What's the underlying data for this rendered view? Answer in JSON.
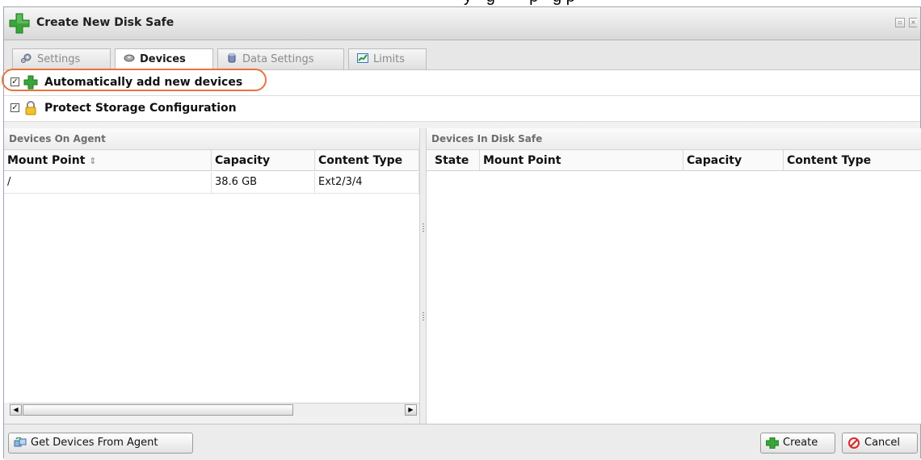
{
  "window": {
    "title": "Create New Disk Safe"
  },
  "tabs": [
    {
      "label": "Settings",
      "icon": "gear-icon"
    },
    {
      "label": "Devices",
      "icon": "disk-icon"
    },
    {
      "label": "Data Settings",
      "icon": "database-icon"
    },
    {
      "label": "Limits",
      "icon": "chart-icon"
    }
  ],
  "active_tab": "Devices",
  "options": {
    "auto_add": {
      "label": "Automatically add new devices",
      "checked": true
    },
    "protect_storage": {
      "label": "Protect Storage Configuration",
      "checked": true
    }
  },
  "agent_panel": {
    "title": "Devices On Agent",
    "columns": [
      "Mount Point",
      "Capacity",
      "Content Type"
    ],
    "sort_indicator": "⇕",
    "rows": [
      {
        "mount_point": "/",
        "capacity": "38.6 GB",
        "content_type": "Ext2/3/4"
      }
    ]
  },
  "safe_panel": {
    "title": "Devices In Disk Safe",
    "columns": [
      "State",
      "Mount Point",
      "Capacity",
      "Content Type"
    ],
    "rows": []
  },
  "footer": {
    "get_devices_label": "Get Devices From Agent",
    "create_label": "Create",
    "cancel_label": "Cancel"
  },
  "colors": {
    "highlight": "#e8743b",
    "plus_green": "#3aa53a",
    "cancel_red": "#d62b2b"
  }
}
